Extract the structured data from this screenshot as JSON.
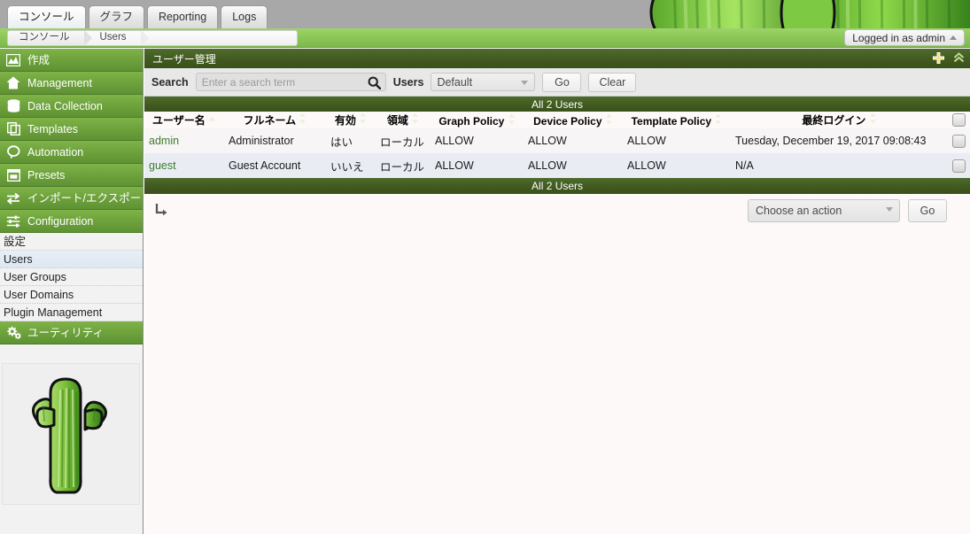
{
  "tabs": [
    {
      "label": "コンソール",
      "active": true
    },
    {
      "label": "グラフ",
      "active": false
    },
    {
      "label": "Reporting",
      "active": false
    },
    {
      "label": "Logs",
      "active": false
    }
  ],
  "breadcrumb": {
    "first": "コンソール",
    "second": "Users"
  },
  "login": {
    "label": "Logged in as admin"
  },
  "sidebar": {
    "sections": [
      {
        "label": "作成",
        "icon": "chart-area-icon"
      },
      {
        "label": "Management",
        "icon": "home-icon"
      },
      {
        "label": "Data Collection",
        "icon": "database-icon"
      },
      {
        "label": "Templates",
        "icon": "copy-icon"
      },
      {
        "label": "Automation",
        "icon": "lasso-icon"
      },
      {
        "label": "Presets",
        "icon": "window-icon"
      },
      {
        "label": "インポート/エクスポート",
        "icon": "exchange-icon"
      },
      {
        "label": "Configuration",
        "icon": "sliders-icon"
      }
    ],
    "subitems": [
      {
        "label": "設定",
        "selected": false
      },
      {
        "label": "Users",
        "selected": true
      },
      {
        "label": "User Groups",
        "selected": false
      },
      {
        "label": "User Domains",
        "selected": false
      },
      {
        "label": "Plugin Management",
        "selected": false
      }
    ],
    "utilities": {
      "label": "ユーティリティ",
      "icon": "cogs-icon"
    },
    "logo_alt": "cacti-cactus-logo"
  },
  "panel": {
    "title": "ユーザー管理",
    "add_icon": "plus-icon",
    "collapse_icon": "double-chevron-up-icon"
  },
  "filter": {
    "search_label": "Search",
    "search_value": "",
    "search_placeholder": "Enter a search term",
    "search_icon": "magnifier-icon",
    "users_label": "Users",
    "users_value": "Default",
    "go_label": "Go",
    "clear_label": "Clear"
  },
  "table": {
    "count_top": "All 2 Users",
    "count_bottom": "All 2 Users",
    "columns": [
      {
        "label": "ユーザー名",
        "sort": "asc"
      },
      {
        "label": "フルネーム",
        "sort": "none"
      },
      {
        "label": "有効",
        "sort": "none"
      },
      {
        "label": "領域",
        "sort": "none"
      },
      {
        "label": "Graph Policy",
        "sort": "none"
      },
      {
        "label": "Device Policy",
        "sort": "none"
      },
      {
        "label": "Template Policy",
        "sort": "none"
      },
      {
        "label": "最終ログイン",
        "sort": "none"
      },
      {
        "label": "",
        "sort": "checkbox"
      }
    ],
    "rows": [
      {
        "username": "admin",
        "fullname": "Administrator",
        "enabled": "はい",
        "realm": "ローカル",
        "graph_policy": "ALLOW",
        "device_policy": "ALLOW",
        "template_policy": "ALLOW",
        "last_login": "Tuesday, December 19, 2017 09:08:43"
      },
      {
        "username": "guest",
        "fullname": "Guest Account",
        "enabled": "いいえ",
        "realm": "ローカル",
        "graph_policy": "ALLOW",
        "device_policy": "ALLOW",
        "template_policy": "ALLOW",
        "last_login": "N/A"
      }
    ]
  },
  "actions": {
    "turn_icon": "arrow-turn-down-right-icon",
    "select_value": "Choose an action",
    "go_label": "Go"
  },
  "colors": {
    "brand_green": "#6da23c",
    "header_dark": "#41591f",
    "col_header": "#6f9d3f",
    "breadcrumb_green": "#8cc857",
    "link_green": "#3e7a2e"
  }
}
